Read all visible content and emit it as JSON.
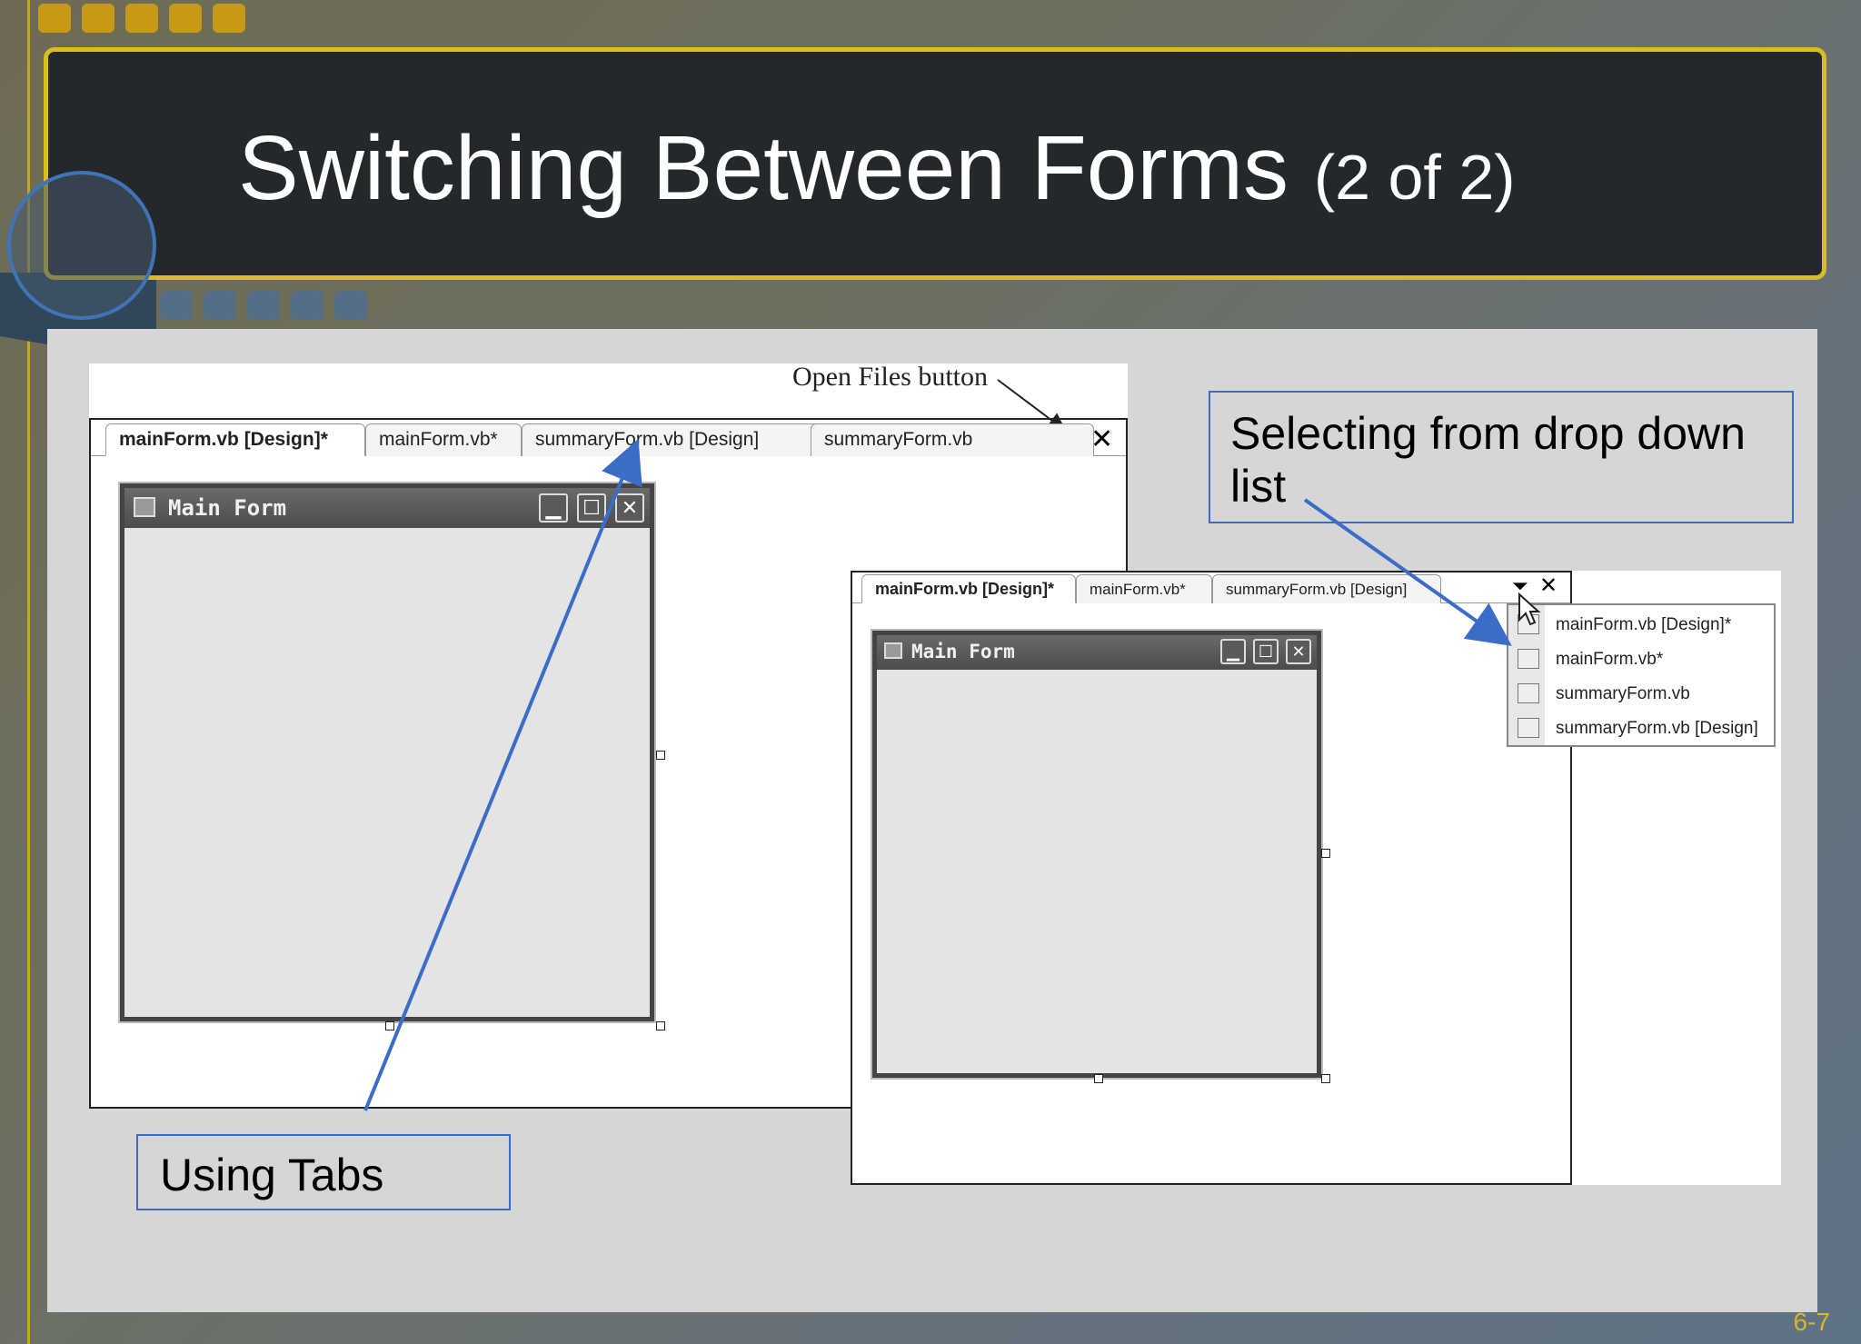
{
  "slide": {
    "title_main": "Switching Between Forms",
    "title_sub": "(2 of 2)",
    "page_number": "6-7"
  },
  "left_ide": {
    "annotation": "Open Files button",
    "tabs": [
      "mainForm.vb [Design]*",
      "mainForm.vb*",
      "summaryForm.vb [Design]",
      "summaryForm.vb"
    ],
    "form_title": "Main Form"
  },
  "right_ide": {
    "tabs": [
      "mainForm.vb [Design]*",
      "mainForm.vb*",
      "summaryForm.vb [Design]"
    ],
    "form_title": "Main Form",
    "dropdown_items": [
      "mainForm.vb [Design]*",
      "mainForm.vb*",
      "summaryForm.vb",
      "summaryForm.vb [Design]"
    ]
  },
  "callouts": {
    "using_tabs": "Using Tabs",
    "dropdown": "Selecting from drop down list"
  },
  "colors": {
    "title_border": "#d8bd25",
    "accent_blue": "#3b6cc8",
    "accent_gold": "#c79a16"
  }
}
